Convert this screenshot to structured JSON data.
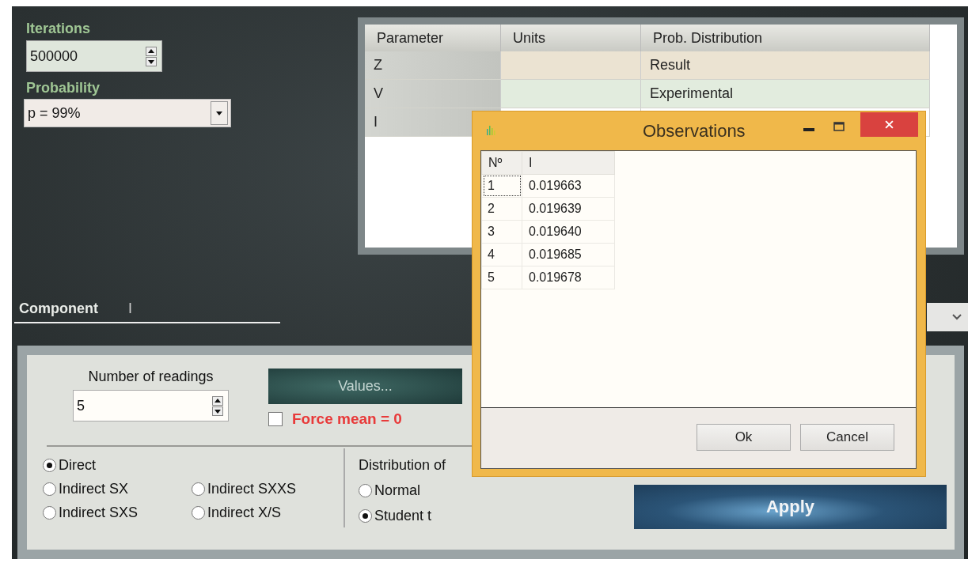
{
  "iterations": {
    "label": "Iterations",
    "value": "500000"
  },
  "probability": {
    "label": "Probability",
    "value": "p = 99%"
  },
  "parameters_table": {
    "columns": [
      "Parameter",
      "Units",
      "Prob. Distribution"
    ],
    "rows": [
      {
        "parameter": "Z",
        "distribution": "Result",
        "kind": "result"
      },
      {
        "parameter": "V",
        "distribution": "Experimental",
        "kind": "experimental"
      },
      {
        "parameter": "I"
      }
    ]
  },
  "component": {
    "label": "Component",
    "value": "I"
  },
  "readings": {
    "label": "Number of readings",
    "value": "5"
  },
  "values_button": "Values...",
  "force_mean": {
    "label": "Force mean = 0",
    "checked": false
  },
  "methods": [
    {
      "label": "Direct",
      "selected": true
    },
    {
      "label": "Indirect SX",
      "selected": false
    },
    {
      "label": "Indirect SXXS",
      "selected": false
    },
    {
      "label": "Indirect SXS",
      "selected": false
    },
    {
      "label": "Indirect X/S",
      "selected": false
    }
  ],
  "distribution": {
    "label": "Distribution of",
    "options": [
      {
        "label": "Normal",
        "selected": false
      },
      {
        "label": "Student t",
        "selected": true
      }
    ]
  },
  "apply_button": "Apply",
  "dialog": {
    "title": "Observations",
    "columns": [
      "Nº",
      "I"
    ],
    "rows": [
      {
        "n": "1",
        "value": "0.019663",
        "focused": true
      },
      {
        "n": "2",
        "value": "0.019639",
        "focused": false
      },
      {
        "n": "3",
        "value": "0.019640",
        "focused": false
      },
      {
        "n": "4",
        "value": "0.019685",
        "focused": false
      },
      {
        "n": "5",
        "value": "0.019678",
        "focused": false
      }
    ],
    "buttons": [
      "Ok",
      "Cancel"
    ]
  }
}
